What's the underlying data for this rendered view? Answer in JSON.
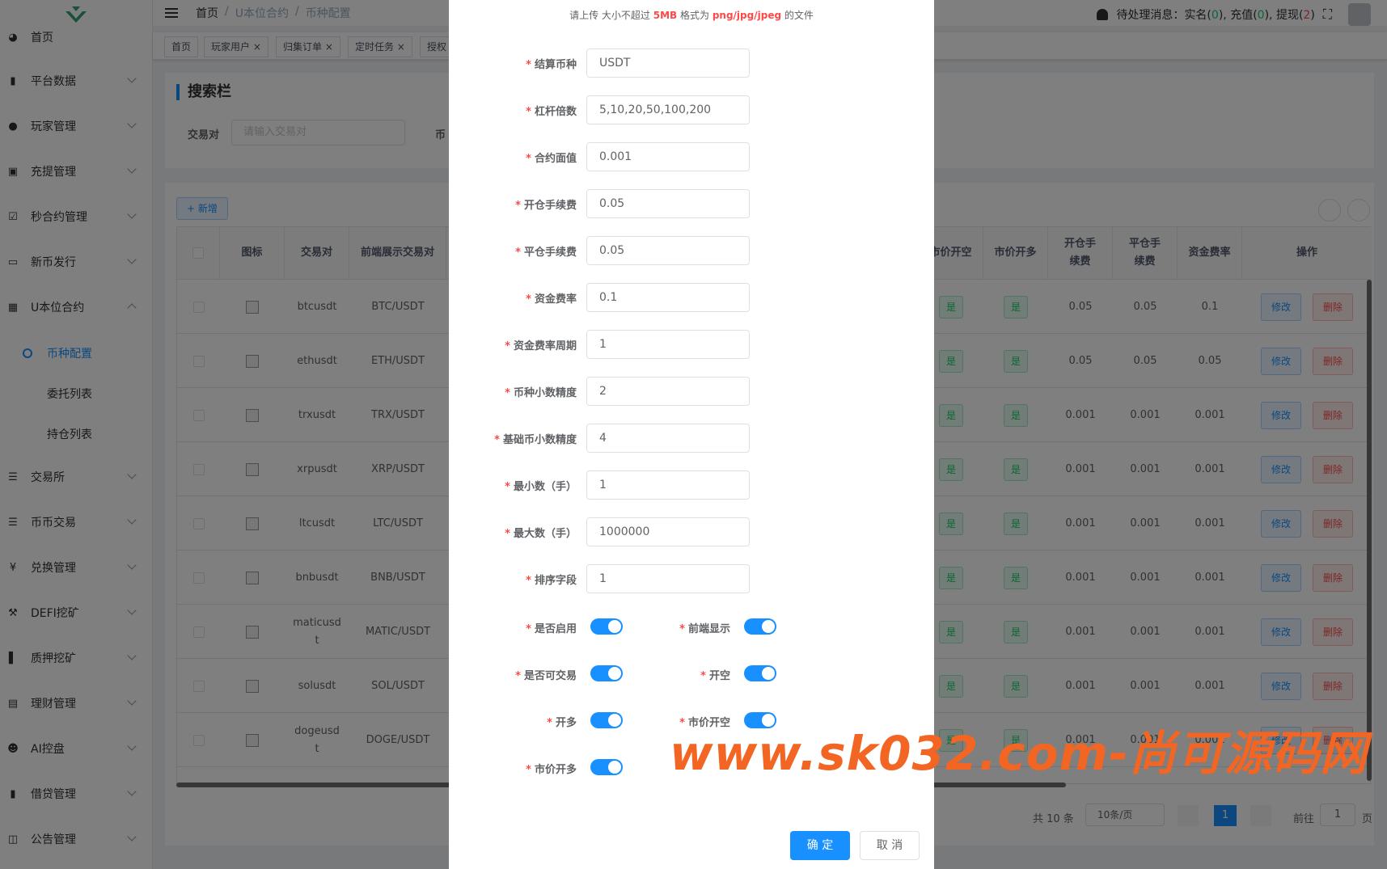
{
  "sidebar": {
    "items": [
      {
        "label": "首页",
        "icon": "dashboard-icon",
        "glyph": "◕"
      },
      {
        "label": "平台数据",
        "icon": "book-icon",
        "glyph": "▮"
      },
      {
        "label": "玩家管理",
        "icon": "user-icon",
        "glyph": "●"
      },
      {
        "label": "充提管理",
        "icon": "copy-icon",
        "glyph": "▣"
      },
      {
        "label": "秒合约管理",
        "icon": "chart-box-icon",
        "glyph": "☑"
      },
      {
        "label": "新币发行",
        "icon": "card-icon",
        "glyph": "▭"
      },
      {
        "label": "U本位合约",
        "icon": "grid-icon",
        "glyph": "▦"
      },
      {
        "label": "交易所",
        "icon": "list-icon",
        "glyph": "☰"
      },
      {
        "label": "币币交易",
        "icon": "list-icon",
        "glyph": "☰"
      },
      {
        "label": "兑换管理",
        "icon": "yen-icon",
        "glyph": "¥"
      },
      {
        "label": "DEFI挖矿",
        "icon": "miner-icon",
        "glyph": "⚒"
      },
      {
        "label": "质押挖矿",
        "icon": "bar-chart-icon",
        "glyph": "▌"
      },
      {
        "label": "理财管理",
        "icon": "document-icon",
        "glyph": "▤"
      },
      {
        "label": "AI控盘",
        "icon": "robot-icon",
        "glyph": "☻"
      },
      {
        "label": "借贷管理",
        "icon": "book-icon",
        "glyph": "▮"
      },
      {
        "label": "公告管理",
        "icon": "book-open-icon",
        "glyph": "◫"
      }
    ],
    "sub_items": [
      "币种配置",
      "委托列表",
      "持仓列表"
    ]
  },
  "header": {
    "breadcrumb": [
      "首页",
      "/",
      "U本位合约",
      "/",
      "币种配置"
    ],
    "pending_label": "待处理消息：",
    "realname_label": "实名(",
    "realname_count": "0",
    "recharge_label": "), 充值(",
    "recharge_count": "0",
    "withdraw_label": "), 提现(",
    "withdraw_count": "2",
    "close_paren": ")"
  },
  "tags": [
    "首页",
    "玩家用户 ×",
    "归集订单 ×",
    "定时任务 ×",
    "授权"
  ],
  "search": {
    "title": "搜索栏",
    "pair_label": "交易对",
    "pair_placeholder": "请输入交易对",
    "coin_label": "币"
  },
  "toolbar": {
    "add_label": "+ 新增"
  },
  "table": {
    "headers": {
      "icon": "图标",
      "pair": "交易对",
      "display_pair": "前端展示交易对",
      "market_short": "市价开空",
      "market_long": "市价开多",
      "open_fee": "开仓手续费",
      "close_fee": "平仓手续费",
      "funding_rate": "资金费率",
      "actions": "操作"
    },
    "yes_label": "是",
    "edit_label": "修改",
    "delete_label": "删除",
    "rows": [
      {
        "pair": "btcusdt",
        "display": "BTC/USDT",
        "open_fee": "0.05",
        "close_fee": "0.05",
        "funding": "0.1"
      },
      {
        "pair": "ethusdt",
        "display": "ETH/USDT",
        "open_fee": "0.05",
        "close_fee": "0.05",
        "funding": "0.05"
      },
      {
        "pair": "trxusdt",
        "display": "TRX/USDT",
        "open_fee": "0.001",
        "close_fee": "0.001",
        "funding": "0.001"
      },
      {
        "pair": "xrpusdt",
        "display": "XRP/USDT",
        "open_fee": "0.001",
        "close_fee": "0.001",
        "funding": "0.001"
      },
      {
        "pair": "ltcusdt",
        "display": "LTC/USDT",
        "open_fee": "0.001",
        "close_fee": "0.001",
        "funding": "0.001"
      },
      {
        "pair": "bnbusdt",
        "display": "BNB/USDT",
        "open_fee": "0.001",
        "close_fee": "0.001",
        "funding": "0.001"
      },
      {
        "pair": "maticusdt",
        "display": "MATIC/USDT",
        "open_fee": "0.001",
        "close_fee": "0.001",
        "funding": "0.001"
      },
      {
        "pair": "solusdt",
        "display": "SOL/USDT",
        "open_fee": "0.001",
        "close_fee": "0.001",
        "funding": "0.001"
      },
      {
        "pair": "dogeusdt",
        "display": "DOGE/USDT",
        "open_fee": "0.001",
        "close_fee": "0.001",
        "funding": "0.001"
      }
    ]
  },
  "pagination": {
    "total": "共 10 条",
    "page_size": "10条/页",
    "current": "1",
    "goto_label": "前往",
    "goto_value": "1",
    "page_suffix": "页"
  },
  "dialog": {
    "upload_tip_prefix": "请上传 大小不超过 ",
    "upload_tip_size": "5MB",
    "upload_tip_mid": " 格式为 ",
    "upload_tip_formats": "png/jpg/jpeg",
    "upload_tip_suffix": " 的文件",
    "fields": [
      {
        "label": "结算币种",
        "value": "USDT"
      },
      {
        "label": "杠杆倍数",
        "value": "5,10,20,50,100,200"
      },
      {
        "label": "合约面值",
        "value": "0.001"
      },
      {
        "label": "开仓手续费",
        "value": "0.05"
      },
      {
        "label": "平仓手续费",
        "value": "0.05"
      },
      {
        "label": "资金费率",
        "value": "0.1"
      },
      {
        "label": "资金费率周期",
        "value": "1"
      },
      {
        "label": "币种小数精度",
        "value": "2"
      },
      {
        "label": "基础币小数精度",
        "value": "4"
      },
      {
        "label": "最小数（手）",
        "value": "1"
      },
      {
        "label": "最大数（手）",
        "value": "1000000"
      },
      {
        "label": "排序字段",
        "value": "1"
      }
    ],
    "switches": [
      {
        "label": "是否启用",
        "on": true
      },
      {
        "label": "前端显示",
        "on": true
      },
      {
        "label": "是否可交易",
        "on": true
      },
      {
        "label": "开空",
        "on": true
      },
      {
        "label": "开多",
        "on": true
      },
      {
        "label": "市价开空",
        "on": true
      },
      {
        "label": "市价开多",
        "on": true
      }
    ],
    "confirm_label": "确 定",
    "cancel_label": "取 消"
  },
  "watermark": "www.sk032.com-尚可源码网",
  "colors": {
    "primary": "#1890ff",
    "danger": "#ff4949",
    "success": "#13ce66",
    "watermark": "#f26522"
  }
}
